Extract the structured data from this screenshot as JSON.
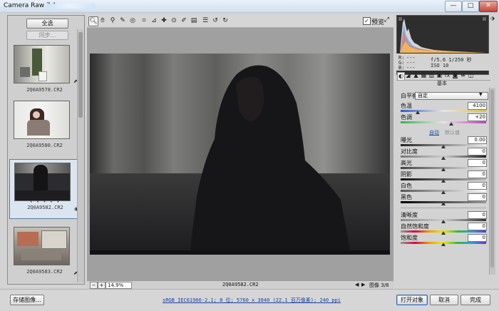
{
  "window": {
    "title": "Camera Raw 7.1 - ",
    "min": "—",
    "max": "□",
    "close": "✕"
  },
  "filmstrip": {
    "select_all": "全选",
    "sync": "同步...",
    "items": [
      {
        "label": "2Q0A9578.CR2",
        "stars": ""
      },
      {
        "label": "2Q0A9580.CR2",
        "stars": ""
      },
      {
        "label": "2Q0A9582.CR2",
        "stars": "• • • • •",
        "selected": true
      },
      {
        "label": "2Q0A9583.CR2",
        "stars": ""
      }
    ]
  },
  "toolbar": {
    "tools": [
      "zoom-icon",
      "hand-icon",
      "white-balance-icon",
      "color-sampler-icon",
      "target-adjust-icon",
      "crop-icon",
      "straighten-icon",
      "spot-removal-icon",
      "red-eye-icon",
      "adjustment-brush-icon",
      "graduated-filter-icon",
      "preferences-icon",
      "rotate-left-icon",
      "rotate-right-icon"
    ],
    "preview_label": "预览",
    "preview_checked": "✓"
  },
  "canvas": {
    "zoom": "14.9%",
    "filename": "2Q0A9582.CR2",
    "image_count": "图像 3/8",
    "prev": "◀",
    "next": "▶"
  },
  "readout": {
    "r": "R:",
    "g": "G:",
    "b": "B:",
    "dashes": "---",
    "exposure": "f/5.6 1/250 秒",
    "iso": "ISO 10"
  },
  "panel": {
    "header": "基本",
    "wb_label": "白平衡:",
    "wb_value": "自定",
    "temperature": {
      "label": "色温",
      "value": "4100"
    },
    "tint": {
      "label": "色调",
      "value": "+20"
    },
    "auto": "自动",
    "default": "默认值",
    "sliders": [
      {
        "label": "曝光",
        "value": "0.00"
      },
      {
        "label": "对比度",
        "value": "0"
      },
      {
        "label": "高光",
        "value": "0"
      },
      {
        "label": "阴影",
        "value": "0"
      },
      {
        "label": "白色",
        "value": "0"
      },
      {
        "label": "黑色",
        "value": "0"
      }
    ],
    "presence": [
      {
        "label": "清晰度",
        "value": "0"
      },
      {
        "label": "自然饱和度",
        "value": "0"
      },
      {
        "label": "饱和度",
        "value": "0"
      }
    ]
  },
  "bottom": {
    "save": "存储图像...",
    "workflow": "sRGB IEC61966-2.1; 8 位; 5760 x 3840 (22.1 百万像素); 240 ppi",
    "open": "打开对象",
    "cancel": "取消",
    "done": "完成"
  },
  "colors": {
    "accent": "#3e6ca8",
    "link": "#1a4fa0"
  }
}
